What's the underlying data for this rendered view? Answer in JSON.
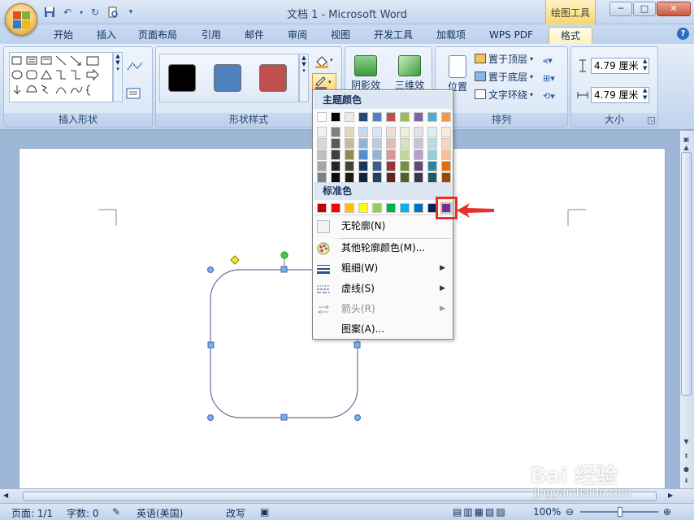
{
  "window": {
    "title": "文档 1 - Microsoft Word",
    "context_tab": "绘图工具",
    "controls": [
      "─",
      "□",
      "✕"
    ]
  },
  "ribbon_tabs": [
    "开始",
    "插入",
    "页面布局",
    "引用",
    "邮件",
    "审阅",
    "视图",
    "开发工具",
    "加载项",
    "WPS PDF",
    "格式"
  ],
  "active_tab": "格式",
  "groups": {
    "insert_shapes": "插入形状",
    "shape_styles": "形状样式",
    "arrange": "排列",
    "size": "大小"
  },
  "style_swatches": [
    "#000000",
    "#4f81bd",
    "#c0504d"
  ],
  "effects": {
    "shadow": "阴影效果",
    "threed": "三维效果"
  },
  "arrange": {
    "position": "位置",
    "bring_front": "置于顶层",
    "send_back": "置于底层",
    "text_wrap": "文字环绕"
  },
  "size": {
    "height": "4.79 厘米",
    "width": "4.79 厘米"
  },
  "dropdown": {
    "theme_colors_header": "主题颜色",
    "standard_colors_header": "标准色",
    "theme_top_row": [
      "#ffffff",
      "#000000",
      "#eeece1",
      "#1f497d",
      "#4f81bd",
      "#c0504d",
      "#9bbb59",
      "#8064a2",
      "#4bacc6",
      "#f79646"
    ],
    "theme_shades": [
      [
        "#f2f2f2",
        "#7f7f7f",
        "#ddd9c3",
        "#c6d9f0",
        "#dbe5f1",
        "#f2dcdb",
        "#ebf1dd",
        "#e5e0ec",
        "#dbeef3",
        "#fdeada"
      ],
      [
        "#d8d8d8",
        "#595959",
        "#c4bd97",
        "#8db3e2",
        "#b8cce4",
        "#e5b9b7",
        "#d7e3bc",
        "#ccc1d9",
        "#b7dde8",
        "#fbd5b5"
      ],
      [
        "#bfbfbf",
        "#3f3f3f",
        "#938953",
        "#548dd4",
        "#95b3d7",
        "#d99694",
        "#c3d69b",
        "#b2a2c7",
        "#92cddc",
        "#fac08f"
      ],
      [
        "#a5a5a5",
        "#262626",
        "#494429",
        "#17365d",
        "#366092",
        "#953734",
        "#76923c",
        "#5f497a",
        "#31859b",
        "#e36c09"
      ],
      [
        "#7f7f7f",
        "#0c0c0c",
        "#1d1b10",
        "#0f243e",
        "#244061",
        "#632423",
        "#4f6128",
        "#3f3151",
        "#205867",
        "#974806"
      ]
    ],
    "standard_colors": [
      "#c00000",
      "#ff0000",
      "#ffc000",
      "#ffff00",
      "#92d050",
      "#00b050",
      "#00b0f0",
      "#0070c0",
      "#002060",
      "#7030a0"
    ],
    "items": {
      "no_outline": "无轮廓(N)",
      "more_colors": "其他轮廓颜色(M)...",
      "weight": "粗细(W)",
      "dashes": "虚线(S)",
      "arrows": "箭头(R)",
      "pattern": "图案(A)..."
    }
  },
  "status": {
    "page": "页面: 1/1",
    "words": "字数: 0",
    "language": "英语(美国)",
    "mode": "改写",
    "zoom": "100%"
  },
  "watermark": {
    "brand": "Bai 经验",
    "url": "jingyan.baidu.com"
  },
  "shape_outline_color": "#8064a2"
}
